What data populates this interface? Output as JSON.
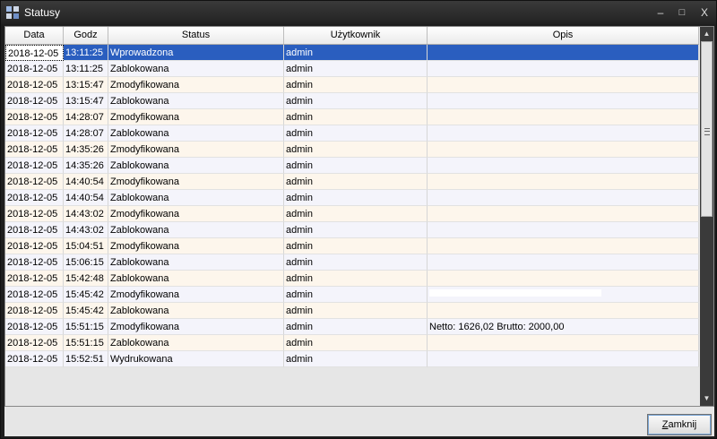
{
  "window": {
    "title": "Statusy",
    "minimize": "–",
    "maximize": "□",
    "close": "X"
  },
  "grid": {
    "columns": [
      "Data",
      "Godz",
      "Status",
      "Użytkownik",
      "Opis"
    ],
    "rows": [
      [
        "2018-12-05",
        "13:11:25",
        "Wprowadzona",
        "admin",
        ""
      ],
      [
        "2018-12-05",
        "13:11:25",
        "Zablokowana",
        "admin",
        ""
      ],
      [
        "2018-12-05",
        "13:15:47",
        "Zmodyfikowana",
        "admin",
        ""
      ],
      [
        "2018-12-05",
        "13:15:47",
        "Zablokowana",
        "admin",
        ""
      ],
      [
        "2018-12-05",
        "14:28:07",
        "Zmodyfikowana",
        "admin",
        ""
      ],
      [
        "2018-12-05",
        "14:28:07",
        "Zablokowana",
        "admin",
        ""
      ],
      [
        "2018-12-05",
        "14:35:26",
        "Zmodyfikowana",
        "admin",
        ""
      ],
      [
        "2018-12-05",
        "14:35:26",
        "Zablokowana",
        "admin",
        ""
      ],
      [
        "2018-12-05",
        "14:40:54",
        "Zmodyfikowana",
        "admin",
        ""
      ],
      [
        "2018-12-05",
        "14:40:54",
        "Zablokowana",
        "admin",
        ""
      ],
      [
        "2018-12-05",
        "14:43:02",
        "Zmodyfikowana",
        "admin",
        ""
      ],
      [
        "2018-12-05",
        "14:43:02",
        "Zablokowana",
        "admin",
        ""
      ],
      [
        "2018-12-05",
        "15:04:51",
        "Zmodyfikowana",
        "admin",
        ""
      ],
      [
        "2018-12-05",
        "15:06:15",
        "Zablokowana",
        "admin",
        ""
      ],
      [
        "2018-12-05",
        "15:42:48",
        "Zablokowana",
        "admin",
        ""
      ],
      [
        "2018-12-05",
        "15:45:42",
        "Zmodyfikowana",
        "admin",
        ""
      ],
      [
        "2018-12-05",
        "15:45:42",
        "Zablokowana",
        "admin",
        ""
      ],
      [
        "2018-12-05",
        "15:51:15",
        "Zmodyfikowana",
        "admin",
        "Netto: 1626,02  Brutto: 2000,00"
      ],
      [
        "2018-12-05",
        "15:51:15",
        "Zablokowana",
        "admin",
        ""
      ],
      [
        "2018-12-05",
        "15:52:51",
        "Wydrukowana",
        "admin",
        ""
      ]
    ],
    "selected_row": 0
  },
  "buttons": {
    "close_prefix": "",
    "close_mnemonic": "Z",
    "close_rest": "amknij"
  },
  "colors": {
    "selection": "#2a5ebf",
    "row_alt_1": "#fdf6ec",
    "row_alt_2": "#f4f4fb",
    "titlebar": "#2a2a2a"
  },
  "icons": {
    "app": "app-window-icon",
    "scroll_up": "arrow-up-icon",
    "scroll_down": "arrow-down-icon"
  }
}
